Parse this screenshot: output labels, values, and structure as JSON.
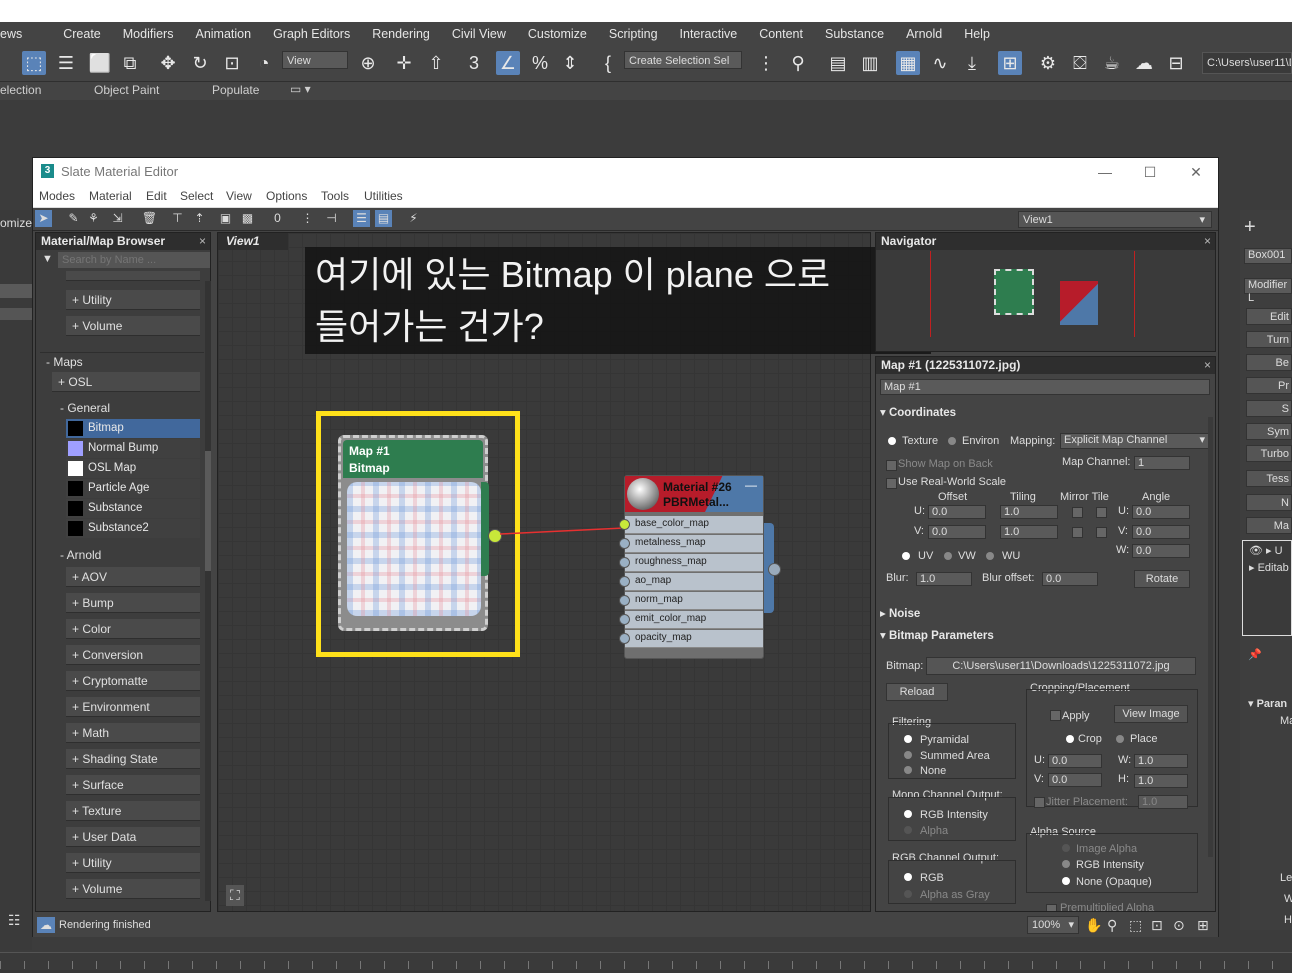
{
  "main_menu": [
    "ews",
    "Create",
    "Modifiers",
    "Animation",
    "Graph Editors",
    "Rendering",
    "Civil View",
    "Customize",
    "Scripting",
    "Interactive",
    "Content",
    "Substance",
    "Arnold",
    "Help"
  ],
  "toolbar": {
    "view_dropdown": "View",
    "selection_set": "Create Selection Sel",
    "path": "C:\\Users\\user11\\D"
  },
  "ribbon": [
    "election",
    "Object Paint",
    "Populate"
  ],
  "left_strip": {
    "label": "omize"
  },
  "right_panel": {
    "object_name": "Box001",
    "modifier_list": "Modifier L",
    "buttons": [
      "Edit",
      "Turn",
      "Be",
      "Pr",
      "S",
      "Sym",
      "Turbo",
      "Tess",
      "N",
      "Ma"
    ],
    "stack": [
      "U",
      "Editab"
    ],
    "params_title": "Paran",
    "params_label": "Ma",
    "bottom": [
      "Le",
      "W",
      "H"
    ]
  },
  "window": {
    "title": "Slate Material Editor",
    "logo": "3",
    "menu": [
      "Modes",
      "Material",
      "Edit",
      "Select",
      "View",
      "Options",
      "Tools",
      "Utilities"
    ],
    "view_dropdown": "View1"
  },
  "browser": {
    "title": "Material/Map Browser",
    "search_placeholder": "Search by Name ...",
    "top_items": [
      "+ Utility",
      "+ Volume"
    ],
    "maps_group": "- Maps",
    "osl": "+ OSL",
    "general_group": "- General",
    "general_items": [
      {
        "name": "Bitmap",
        "color": "#000000",
        "selected": true
      },
      {
        "name": "Normal Bump",
        "color": "#9f9fff",
        "selected": false
      },
      {
        "name": "OSL Map",
        "color": "#ffffff",
        "selected": false
      },
      {
        "name": "Particle Age",
        "color": "#000000",
        "selected": false
      },
      {
        "name": "Substance",
        "color": "#000000",
        "selected": false
      },
      {
        "name": "Substance2",
        "color": "#000000",
        "selected": false
      }
    ],
    "arnold_group": "- Arnold",
    "arnold_items": [
      "+ AOV",
      "+ Bump",
      "+ Color",
      "+ Conversion",
      "+ Cryptomatte",
      "+ Environment",
      "+ Math",
      "+ Shading State",
      "+ Surface",
      "+ Texture",
      "+ User Data",
      "+ Utility",
      "+ Volume"
    ]
  },
  "view": {
    "tab": "View1",
    "overlay_line1": "여기에 있는 Bitmap 이 plane 으로",
    "overlay_line2": "들어가는 건가?",
    "bitmap_node": {
      "title": "Map #1",
      "subtitle": "Bitmap"
    },
    "material_node": {
      "title": "Material #26",
      "subtitle": "PBRMetal...",
      "slots": [
        "base_color_map",
        "metalness_map",
        "roughness_map",
        "ao_map",
        "norm_map",
        "emit_color_map",
        "opacity_map"
      ]
    },
    "highlight_color": "#ffe11a"
  },
  "navigator": {
    "title": "Navigator"
  },
  "params": {
    "title": "Map #1 (1225311072.jpg)",
    "name": "Map #1",
    "coordinates": "Coordinates",
    "texture": "Texture",
    "environ": "Environ",
    "mapping_label": "Mapping:",
    "mapping": "Explicit Map Channel",
    "show_map_on_back": "Show Map on Back",
    "map_channel_label": "Map Channel:",
    "map_channel": "1",
    "real_world": "Use Real-World Scale",
    "col_offset": "Offset",
    "col_tiling": "Tiling",
    "col_mirror": "Mirror Tile",
    "col_angle": "Angle",
    "u_label": "U:",
    "v_label": "V:",
    "w_label": "W:",
    "u_offset": "0.0",
    "v_offset": "0.0",
    "u_tiling": "1.0",
    "v_tiling": "1.0",
    "u_angle": "0.0",
    "v_angle": "0.0",
    "w_angle": "0.0",
    "uv": "UV",
    "vw": "VW",
    "wu": "WU",
    "blur_label": "Blur:",
    "blur": "1.0",
    "blur_offset_label": "Blur offset:",
    "blur_offset": "0.0",
    "rotate": "Rotate",
    "noise": "Noise",
    "bitmap_params": "Bitmap Parameters",
    "bitmap_label": "Bitmap:",
    "bitmap_path": "C:\\Users\\user11\\Downloads\\1225311072.jpg",
    "reload": "Reload",
    "cropping": "Cropping/Placement",
    "apply": "Apply",
    "view_image": "View Image",
    "crop": "Crop",
    "place": "Place",
    "filtering": "Filtering",
    "pyramidal": "Pyramidal",
    "summed_area": "Summed Area",
    "none": "None",
    "cu": "0.0",
    "cv": "0.0",
    "cw": "1.0",
    "ch": "1.0",
    "h_label": "H:",
    "mono_output": "Mono Channel Output:",
    "rgb_intensity": "RGB Intensity",
    "alpha": "Alpha",
    "jitter": "Jitter Placement:",
    "jitter_val": "1.0",
    "alpha_source": "Alpha Source",
    "image_alpha": "Image Alpha",
    "rgb_intensity2": "RGB Intensity",
    "none_opaque": "None (Opaque)",
    "rgb_output": "RGB Channel Output:",
    "rgb": "RGB",
    "alpha_gray": "Alpha as Gray",
    "premult": "Premultiplied Alpha"
  },
  "status": {
    "text": "Rendering finished",
    "zoom": "100%"
  }
}
